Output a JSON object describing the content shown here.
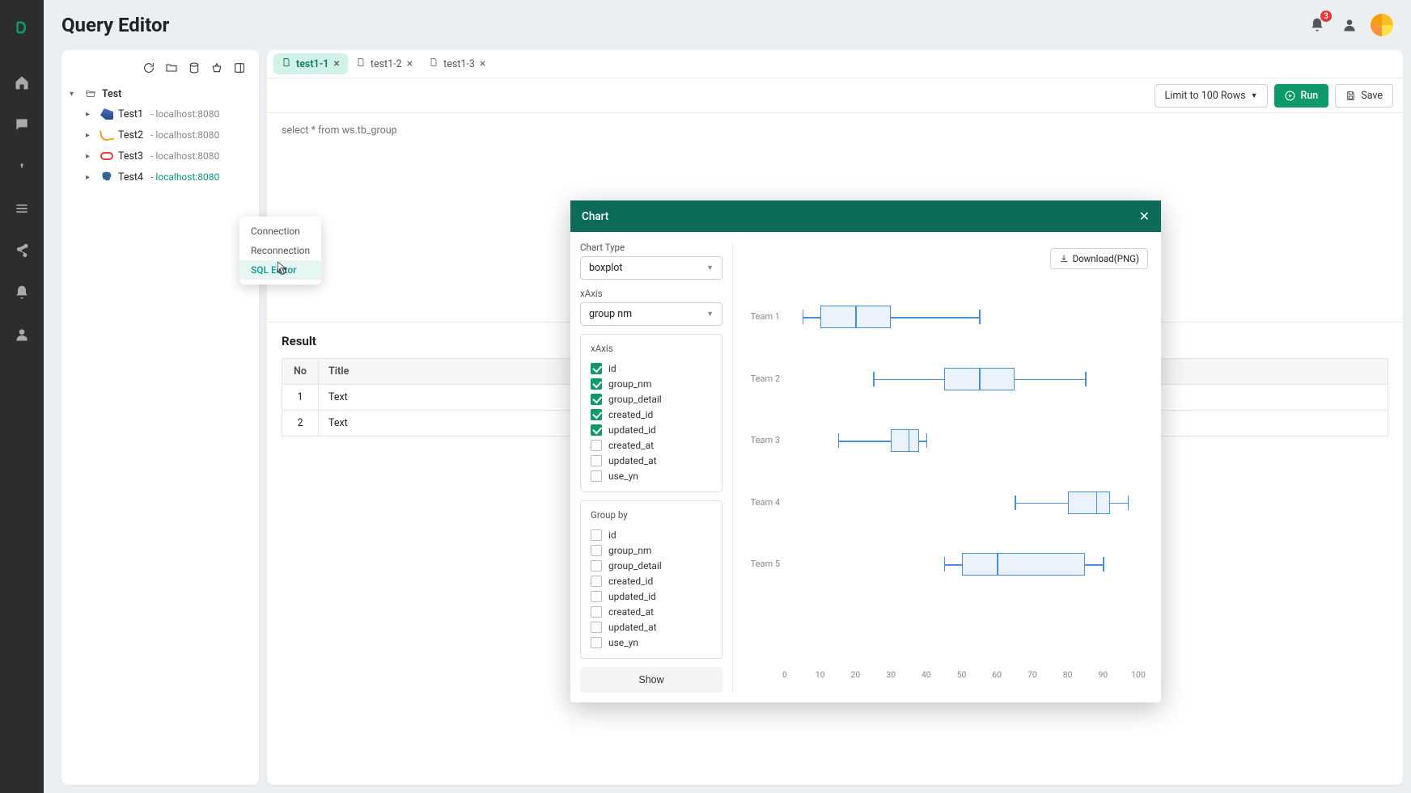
{
  "page_title": "Query Editor",
  "notifications_count": "3",
  "nav_items": [
    "home",
    "message",
    "refresh",
    "list",
    "share",
    "bell",
    "admin"
  ],
  "tree": {
    "root_label": "Test",
    "connections": [
      {
        "name": "Test1",
        "host": "- localhost:8080",
        "db": "maria",
        "active": false
      },
      {
        "name": "Test2",
        "host": "- localhost:8080",
        "db": "mysql",
        "active": false
      },
      {
        "name": "Test3",
        "host": "- localhost:8080",
        "db": "oracle",
        "active": false
      },
      {
        "name": "Test4",
        "host": "- localhost:8080",
        "db": "postgres",
        "active": true
      }
    ]
  },
  "context_menu": {
    "items": [
      {
        "label": "Connection",
        "highlight": false
      },
      {
        "label": "Reconnection",
        "highlight": false
      },
      {
        "label": "SQL Editor",
        "highlight": true
      }
    ]
  },
  "tabs": [
    {
      "label": "test1-1",
      "active": true
    },
    {
      "label": "test1-2",
      "active": false
    },
    {
      "label": "test1-3",
      "active": false
    }
  ],
  "toolbar": {
    "limit_label": "Limit to 100 Rows",
    "run_label": "Run",
    "save_label": "Save"
  },
  "sql_text": "select * from ws.tb_group",
  "result": {
    "title": "Result",
    "columns": [
      "No",
      "Title"
    ],
    "rows": [
      [
        "1",
        "Text"
      ],
      [
        "2",
        "Text"
      ]
    ]
  },
  "chart_modal": {
    "title": "Chart",
    "download_label": "Download(PNG)",
    "chart_type_label": "Chart Type",
    "chart_type_value": "boxplot",
    "xaxis_label": "xAxis",
    "xaxis_value": "group nm",
    "yaxis_section_label": "xAxis",
    "groupby_label": "Group by",
    "show_label": "Show",
    "yaxis_fields": [
      {
        "label": "id",
        "checked": true
      },
      {
        "label": "group_nm",
        "checked": true
      },
      {
        "label": "group_detail",
        "checked": true
      },
      {
        "label": "created_id",
        "checked": true
      },
      {
        "label": "updated_id",
        "checked": true
      },
      {
        "label": "created_at",
        "checked": false
      },
      {
        "label": "updated_at",
        "checked": false
      },
      {
        "label": "use_yn",
        "checked": false
      }
    ],
    "groupby_fields": [
      {
        "label": "id",
        "checked": false
      },
      {
        "label": "group_nm",
        "checked": false
      },
      {
        "label": "group_detail",
        "checked": false
      },
      {
        "label": "created_id",
        "checked": false
      },
      {
        "label": "updated_id",
        "checked": false
      },
      {
        "label": "created_at",
        "checked": false
      },
      {
        "label": "updated_at",
        "checked": false
      },
      {
        "label": "use_yn",
        "checked": false
      }
    ]
  },
  "chart_data": {
    "type": "boxplot",
    "xlabel": "",
    "ylabel": "",
    "categories": [
      "Team 1",
      "Team 2",
      "Team 3",
      "Team 4",
      "Team 5"
    ],
    "series": [
      {
        "name": "Team 1",
        "min": 5,
        "q1": 10,
        "median": 20,
        "q3": 30,
        "max": 55
      },
      {
        "name": "Team 2",
        "min": 25,
        "q1": 45,
        "median": 55,
        "q3": 65,
        "max": 85
      },
      {
        "name": "Team 3",
        "min": 15,
        "q1": 30,
        "median": 35,
        "q3": 38,
        "max": 40
      },
      {
        "name": "Team 4",
        "min": 65,
        "q1": 80,
        "median": 88,
        "q3": 92,
        "max": 97
      },
      {
        "name": "Team 5",
        "min": 45,
        "q1": 50,
        "median": 60,
        "q3": 85,
        "max": 90
      }
    ],
    "x_ticks": [
      0,
      10,
      20,
      30,
      40,
      50,
      60,
      70,
      80,
      90,
      100
    ],
    "xlim": [
      0,
      100
    ]
  }
}
